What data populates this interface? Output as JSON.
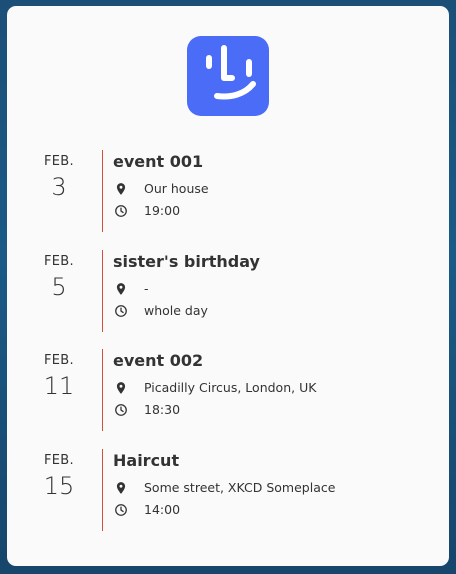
{
  "events": [
    {
      "month": "FEB.",
      "day": "3",
      "title": "event 001",
      "location": "Our house",
      "time": "19:00"
    },
    {
      "month": "FEB.",
      "day": "5",
      "title": "sister's birthday",
      "location": "-",
      "time": "whole day"
    },
    {
      "month": "FEB.",
      "day": "11",
      "title": "event 002",
      "location": "Picadilly Circus, London, UK",
      "time": "18:30"
    },
    {
      "month": "FEB.",
      "day": "15",
      "title": "Haircut",
      "location": "Some street, XKCD Someplace",
      "time": "14:00"
    }
  ],
  "colors": {
    "accent_bar": "#d4503a",
    "logo_bg": "#4a6cf6"
  },
  "icons": {
    "logo": "smiley-face-logo-icon",
    "location": "location-pin-icon",
    "time": "clock-icon"
  }
}
